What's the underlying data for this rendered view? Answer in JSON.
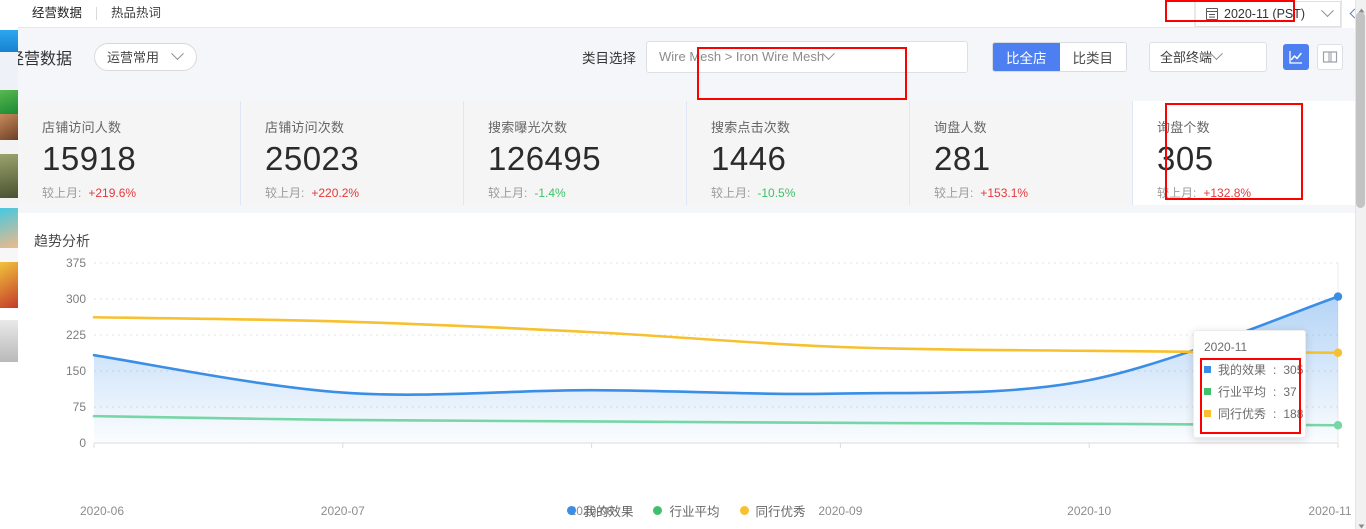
{
  "topbar": {
    "tabs": [
      {
        "label": "经营数据",
        "active": true
      },
      {
        "label": "热品热词",
        "active": false
      }
    ],
    "date_value": "2020-11 (PST)",
    "calendar_icon": "calendar-icon",
    "caret_icon": "chevron-down-icon",
    "collapse_icon": "chevron-left-icon"
  },
  "filters": {
    "page_title": "经营数据",
    "preset_value": "运营常用",
    "category_label": "类目选择",
    "category_value": "Wire Mesh > Iron Wire Mesh",
    "compare": [
      {
        "label": "比全店",
        "active": true
      },
      {
        "label": "比类目",
        "active": false
      }
    ],
    "terminal_value": "全部终端",
    "view_buttons": [
      {
        "icon": "line-chart-icon",
        "active": true
      },
      {
        "icon": "table-columns-icon",
        "active": false
      }
    ]
  },
  "kpis": [
    {
      "name": "店铺访问人数",
      "value": "15918",
      "delta_label": "较上月:",
      "delta": "+219.6%",
      "dir": "up",
      "selected": false
    },
    {
      "name": "店铺访问次数",
      "value": "25023",
      "delta_label": "较上月:",
      "delta": "+220.2%",
      "dir": "up",
      "selected": false
    },
    {
      "name": "搜索曝光次数",
      "value": "126495",
      "delta_label": "较上月:",
      "delta": "-1.4%",
      "dir": "down",
      "selected": false
    },
    {
      "name": "搜索点击次数",
      "value": "1446",
      "delta_label": "较上月:",
      "delta": "-10.5%",
      "dir": "down",
      "selected": false
    },
    {
      "name": "询盘人数",
      "value": "281",
      "delta_label": "较上月:",
      "delta": "+153.1%",
      "dir": "up",
      "selected": false
    },
    {
      "name": "询盘个数",
      "value": "305",
      "delta_label": "较上月:",
      "delta": "+132.8%",
      "dir": "up",
      "selected": true
    }
  ],
  "chart_panel": {
    "title": "趋势分析"
  },
  "tooltip": {
    "title": "2020-11",
    "rows": [
      {
        "label": "我的效果",
        "value": "305",
        "color": "#3a8ee6"
      },
      {
        "label": "行业平均",
        "value": "37",
        "color": "#3ec16a"
      },
      {
        "label": "同行优秀",
        "value": "188",
        "color": "#f7c02e"
      }
    ]
  },
  "chart_data": {
    "type": "line",
    "title": "趋势分析",
    "xlabel": "",
    "ylabel": "",
    "x": [
      "2020-06",
      "2020-07",
      "2020-08",
      "2020-09",
      "2020-10",
      "2020-11"
    ],
    "categories": [
      "2020-06",
      "2020-07",
      "2020-08",
      "2020-09",
      "2020-10",
      "2020-11"
    ],
    "ylim": [
      0,
      375
    ],
    "yticks": [
      0,
      75,
      150,
      225,
      300,
      375
    ],
    "grid": true,
    "smooth": true,
    "legend_position": "bottom",
    "series": [
      {
        "name": "我的效果",
        "color": "#3a8ee6",
        "area": true,
        "values": [
          183,
          105,
          110,
          103,
          131,
          305
        ]
      },
      {
        "name": "行业平均",
        "color": "#77d6a5",
        "area": false,
        "values": [
          56,
          48,
          45,
          42,
          40,
          37
        ]
      },
      {
        "name": "同行优秀",
        "color": "#f7c02e",
        "area": false,
        "values": [
          262,
          253,
          231,
          200,
          192,
          188
        ]
      }
    ]
  },
  "annotations": [
    {
      "name": "date-picker-highlight"
    },
    {
      "name": "category-select-highlight"
    },
    {
      "name": "inquiry-count-card-highlight"
    },
    {
      "name": "tooltip-rows-highlight"
    }
  ]
}
